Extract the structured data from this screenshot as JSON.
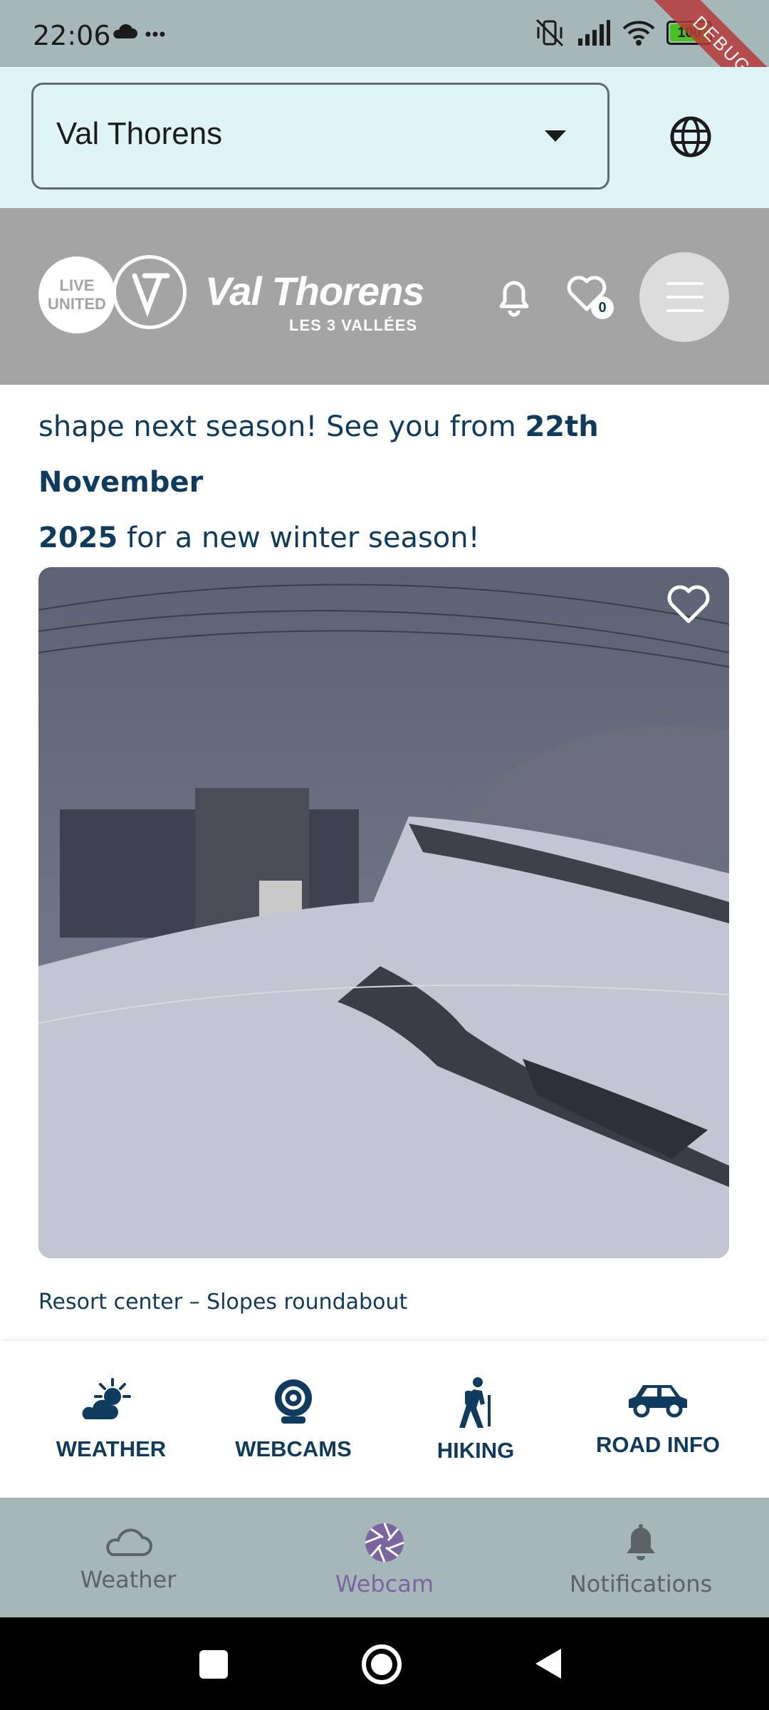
{
  "status_bar": {
    "time": "22:06",
    "battery": "100",
    "debug_label": "DEBUG"
  },
  "resort_selector": {
    "value": "Val Thorens"
  },
  "header": {
    "logo_live_line1": "LIVE",
    "logo_live_line2": "UNITED",
    "logo_name": "Val Thorens",
    "logo_sub": "LES 3 VALLÉES",
    "favorites_count": "0"
  },
  "content": {
    "paragraph_part1": "shape next season! See you from ",
    "paragraph_bold1": "22th November",
    "paragraph_bold2": "2025",
    "paragraph_part2": " for a new winter season!",
    "webcam_caption": "Resort center – Slopes roundabout"
  },
  "quick_links": [
    {
      "label": "WEATHER",
      "icon": "weather-icon"
    },
    {
      "label": "WEBCAMS",
      "icon": "webcam-icon"
    },
    {
      "label": "HIKING",
      "icon": "hiking-icon"
    },
    {
      "label": "ROAD INFO",
      "icon": "car-icon"
    }
  ],
  "bottom_nav": [
    {
      "label": "Weather",
      "icon": "cloud-icon",
      "active": false
    },
    {
      "label": "Webcam",
      "icon": "aperture-icon",
      "active": true
    },
    {
      "label": "Notifications",
      "icon": "bell-icon",
      "active": false
    }
  ],
  "colors": {
    "brand_navy": "#0e3b5e",
    "header_gray": "#a4a4a4",
    "resort_bar_bg": "#dff4f7",
    "nav_active": "#7b659f",
    "status_bar_bg": "#a6b7ba"
  }
}
